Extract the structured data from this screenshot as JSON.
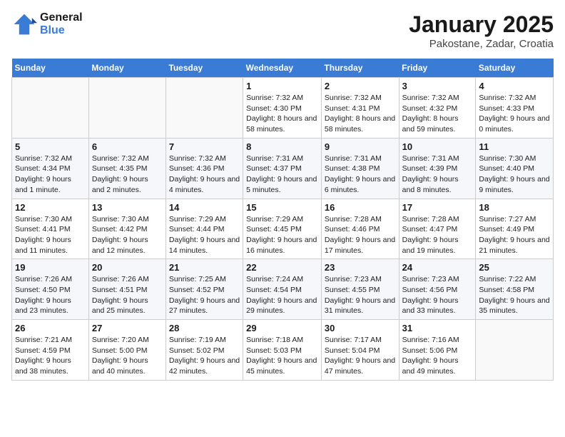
{
  "logo": {
    "line1": "General",
    "line2": "Blue"
  },
  "title": "January 2025",
  "location": "Pakostane, Zadar, Croatia",
  "weekdays": [
    "Sunday",
    "Monday",
    "Tuesday",
    "Wednesday",
    "Thursday",
    "Friday",
    "Saturday"
  ],
  "weeks": [
    [
      {
        "day": "",
        "info": ""
      },
      {
        "day": "",
        "info": ""
      },
      {
        "day": "",
        "info": ""
      },
      {
        "day": "1",
        "info": "Sunrise: 7:32 AM\nSunset: 4:30 PM\nDaylight: 8 hours and 58 minutes."
      },
      {
        "day": "2",
        "info": "Sunrise: 7:32 AM\nSunset: 4:31 PM\nDaylight: 8 hours and 58 minutes."
      },
      {
        "day": "3",
        "info": "Sunrise: 7:32 AM\nSunset: 4:32 PM\nDaylight: 8 hours and 59 minutes."
      },
      {
        "day": "4",
        "info": "Sunrise: 7:32 AM\nSunset: 4:33 PM\nDaylight: 9 hours and 0 minutes."
      }
    ],
    [
      {
        "day": "5",
        "info": "Sunrise: 7:32 AM\nSunset: 4:34 PM\nDaylight: 9 hours and 1 minute."
      },
      {
        "day": "6",
        "info": "Sunrise: 7:32 AM\nSunset: 4:35 PM\nDaylight: 9 hours and 2 minutes."
      },
      {
        "day": "7",
        "info": "Sunrise: 7:32 AM\nSunset: 4:36 PM\nDaylight: 9 hours and 4 minutes."
      },
      {
        "day": "8",
        "info": "Sunrise: 7:31 AM\nSunset: 4:37 PM\nDaylight: 9 hours and 5 minutes."
      },
      {
        "day": "9",
        "info": "Sunrise: 7:31 AM\nSunset: 4:38 PM\nDaylight: 9 hours and 6 minutes."
      },
      {
        "day": "10",
        "info": "Sunrise: 7:31 AM\nSunset: 4:39 PM\nDaylight: 9 hours and 8 minutes."
      },
      {
        "day": "11",
        "info": "Sunrise: 7:30 AM\nSunset: 4:40 PM\nDaylight: 9 hours and 9 minutes."
      }
    ],
    [
      {
        "day": "12",
        "info": "Sunrise: 7:30 AM\nSunset: 4:41 PM\nDaylight: 9 hours and 11 minutes."
      },
      {
        "day": "13",
        "info": "Sunrise: 7:30 AM\nSunset: 4:42 PM\nDaylight: 9 hours and 12 minutes."
      },
      {
        "day": "14",
        "info": "Sunrise: 7:29 AM\nSunset: 4:44 PM\nDaylight: 9 hours and 14 minutes."
      },
      {
        "day": "15",
        "info": "Sunrise: 7:29 AM\nSunset: 4:45 PM\nDaylight: 9 hours and 16 minutes."
      },
      {
        "day": "16",
        "info": "Sunrise: 7:28 AM\nSunset: 4:46 PM\nDaylight: 9 hours and 17 minutes."
      },
      {
        "day": "17",
        "info": "Sunrise: 7:28 AM\nSunset: 4:47 PM\nDaylight: 9 hours and 19 minutes."
      },
      {
        "day": "18",
        "info": "Sunrise: 7:27 AM\nSunset: 4:49 PM\nDaylight: 9 hours and 21 minutes."
      }
    ],
    [
      {
        "day": "19",
        "info": "Sunrise: 7:26 AM\nSunset: 4:50 PM\nDaylight: 9 hours and 23 minutes."
      },
      {
        "day": "20",
        "info": "Sunrise: 7:26 AM\nSunset: 4:51 PM\nDaylight: 9 hours and 25 minutes."
      },
      {
        "day": "21",
        "info": "Sunrise: 7:25 AM\nSunset: 4:52 PM\nDaylight: 9 hours and 27 minutes."
      },
      {
        "day": "22",
        "info": "Sunrise: 7:24 AM\nSunset: 4:54 PM\nDaylight: 9 hours and 29 minutes."
      },
      {
        "day": "23",
        "info": "Sunrise: 7:23 AM\nSunset: 4:55 PM\nDaylight: 9 hours and 31 minutes."
      },
      {
        "day": "24",
        "info": "Sunrise: 7:23 AM\nSunset: 4:56 PM\nDaylight: 9 hours and 33 minutes."
      },
      {
        "day": "25",
        "info": "Sunrise: 7:22 AM\nSunset: 4:58 PM\nDaylight: 9 hours and 35 minutes."
      }
    ],
    [
      {
        "day": "26",
        "info": "Sunrise: 7:21 AM\nSunset: 4:59 PM\nDaylight: 9 hours and 38 minutes."
      },
      {
        "day": "27",
        "info": "Sunrise: 7:20 AM\nSunset: 5:00 PM\nDaylight: 9 hours and 40 minutes."
      },
      {
        "day": "28",
        "info": "Sunrise: 7:19 AM\nSunset: 5:02 PM\nDaylight: 9 hours and 42 minutes."
      },
      {
        "day": "29",
        "info": "Sunrise: 7:18 AM\nSunset: 5:03 PM\nDaylight: 9 hours and 45 minutes."
      },
      {
        "day": "30",
        "info": "Sunrise: 7:17 AM\nSunset: 5:04 PM\nDaylight: 9 hours and 47 minutes."
      },
      {
        "day": "31",
        "info": "Sunrise: 7:16 AM\nSunset: 5:06 PM\nDaylight: 9 hours and 49 minutes."
      },
      {
        "day": "",
        "info": ""
      }
    ]
  ]
}
